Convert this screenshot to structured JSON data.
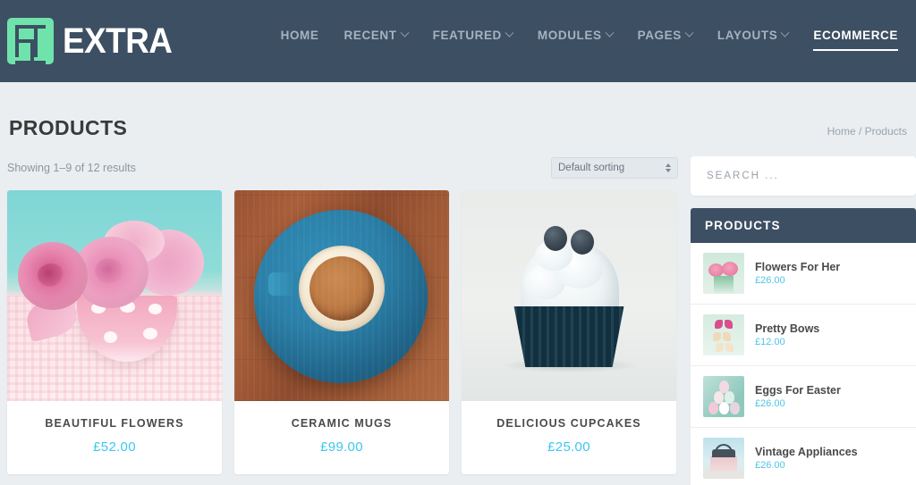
{
  "header": {
    "logo_text": "EXTRA",
    "logo_icon": "extra-e-logo",
    "nav": [
      {
        "label": "HOME",
        "has_dropdown": false,
        "active": false
      },
      {
        "label": "RECENT",
        "has_dropdown": true,
        "active": false
      },
      {
        "label": "FEATURED",
        "has_dropdown": true,
        "active": false
      },
      {
        "label": "MODULES",
        "has_dropdown": true,
        "active": false
      },
      {
        "label": "PAGES",
        "has_dropdown": true,
        "active": false
      },
      {
        "label": "LAYOUTS",
        "has_dropdown": true,
        "active": false
      },
      {
        "label": "ECOMMERCE",
        "has_dropdown": false,
        "active": true
      }
    ]
  },
  "page": {
    "title": "PRODUCTS",
    "breadcrumb": "Home / Products",
    "results_count": "Showing 1–9 of 12 results"
  },
  "toolbar": {
    "sort_selected": "Default sorting",
    "sort_icon": "updown-arrows-icon"
  },
  "products": [
    {
      "name": "BEAUTIFUL FLOWERS",
      "price": "£52.00",
      "image": "pink-roses-in-polka-dot-bowl"
    },
    {
      "name": "CERAMIC MUGS",
      "price": "£99.00",
      "image": "blue-cup-and-saucer-on-wood"
    },
    {
      "name": "DELICIOUS CUPCAKES",
      "price": "£25.00",
      "image": "cupcake-with-white-frosting"
    }
  ],
  "sidebar": {
    "search": {
      "placeholder": "SEARCH ...",
      "value": ""
    },
    "widget": {
      "title": "PRODUCTS",
      "items": [
        {
          "name": "Flowers For Her",
          "price": "£26.00",
          "thumb": "pink-flowers-thumb"
        },
        {
          "name": "Pretty Bows",
          "price": "£12.00",
          "thumb": "ribbon-bows-thumb"
        },
        {
          "name": "Eggs For Easter",
          "price": "£26.00",
          "thumb": "easter-eggs-thumb"
        },
        {
          "name": "Vintage Appliances",
          "price": "£26.00",
          "thumb": "vintage-appliance-thumb"
        }
      ]
    }
  },
  "colors": {
    "header_bg": "#3d4f63",
    "page_bg": "#eaeef1",
    "accent_green": "#6fe3ab",
    "price_blue": "#3ec6ef",
    "widget_price_blue": "#4cc4e8"
  }
}
